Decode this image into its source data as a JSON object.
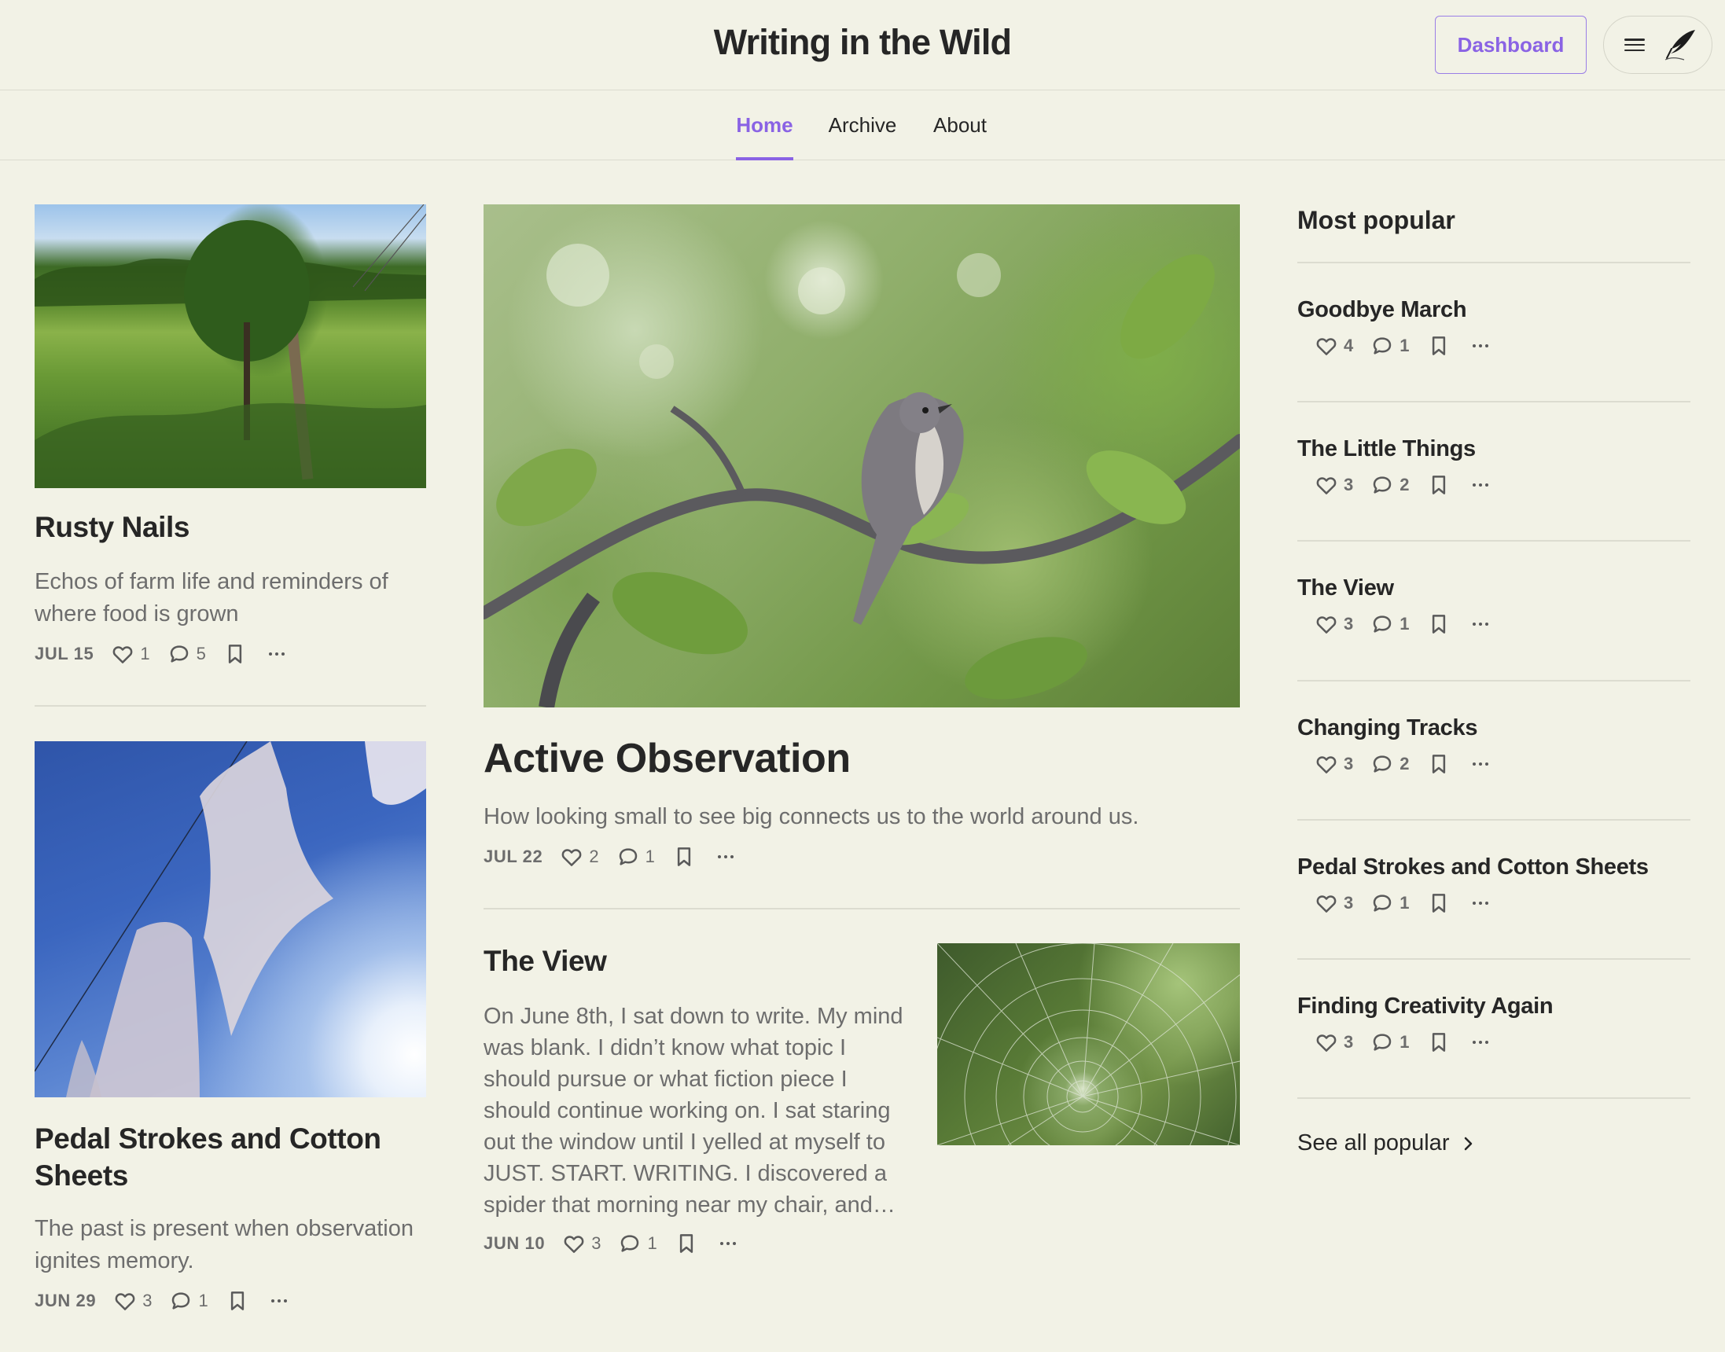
{
  "header": {
    "site_title": "Writing in the Wild",
    "dashboard_label": "Dashboard",
    "menu_icon": "hamburger-icon",
    "avatar_icon": "quill-avatar-icon"
  },
  "nav": {
    "tabs": [
      {
        "label": "Home",
        "active": true
      },
      {
        "label": "Archive",
        "active": false
      },
      {
        "label": "About",
        "active": false
      }
    ]
  },
  "posts": {
    "rusty_nails": {
      "title": "Rusty Nails",
      "subtitle": "Echos of farm life and reminders of where food is grown",
      "date": "JUL 15",
      "likes": "1",
      "comments": "5"
    },
    "pedal_strokes": {
      "title": "Pedal Strokes and Cotton Sheets",
      "subtitle": "The past is present when observation ignites memory.",
      "date": "JUN 29",
      "likes": "3",
      "comments": "1"
    },
    "active_observation": {
      "title": "Active Observation",
      "subtitle": "How looking small to see big connects us to the world around us.",
      "date": "JUL 22",
      "likes": "2",
      "comments": "1"
    },
    "the_view": {
      "title": "The View",
      "excerpt": "On June 8th, I sat down to write. My mind was blank. I didn’t know what topic I should pursue or what fiction piece I should continue working on. I sat staring out the window until I yelled at myself to JUST. START. WRITING. I discovered a spider that morning near my chair, and…",
      "date": "JUN 10",
      "likes": "3",
      "comments": "1"
    }
  },
  "sidebar": {
    "heading": "Most popular",
    "items": [
      {
        "title": "Goodbye March",
        "likes": "4",
        "comments": "1"
      },
      {
        "title": "The Little Things",
        "likes": "3",
        "comments": "2"
      },
      {
        "title": "The View",
        "likes": "3",
        "comments": "1"
      },
      {
        "title": "Changing Tracks",
        "likes": "3",
        "comments": "2"
      },
      {
        "title": "Pedal Strokes and Cotton Sheets",
        "likes": "3",
        "comments": "1"
      },
      {
        "title": "Finding Creativity Again",
        "likes": "3",
        "comments": "1"
      }
    ],
    "see_all_label": "See all popular"
  },
  "colors": {
    "background": "#f2f2e6",
    "accent": "#8a63e4",
    "text": "#262626",
    "muted": "#6d6d6d"
  }
}
